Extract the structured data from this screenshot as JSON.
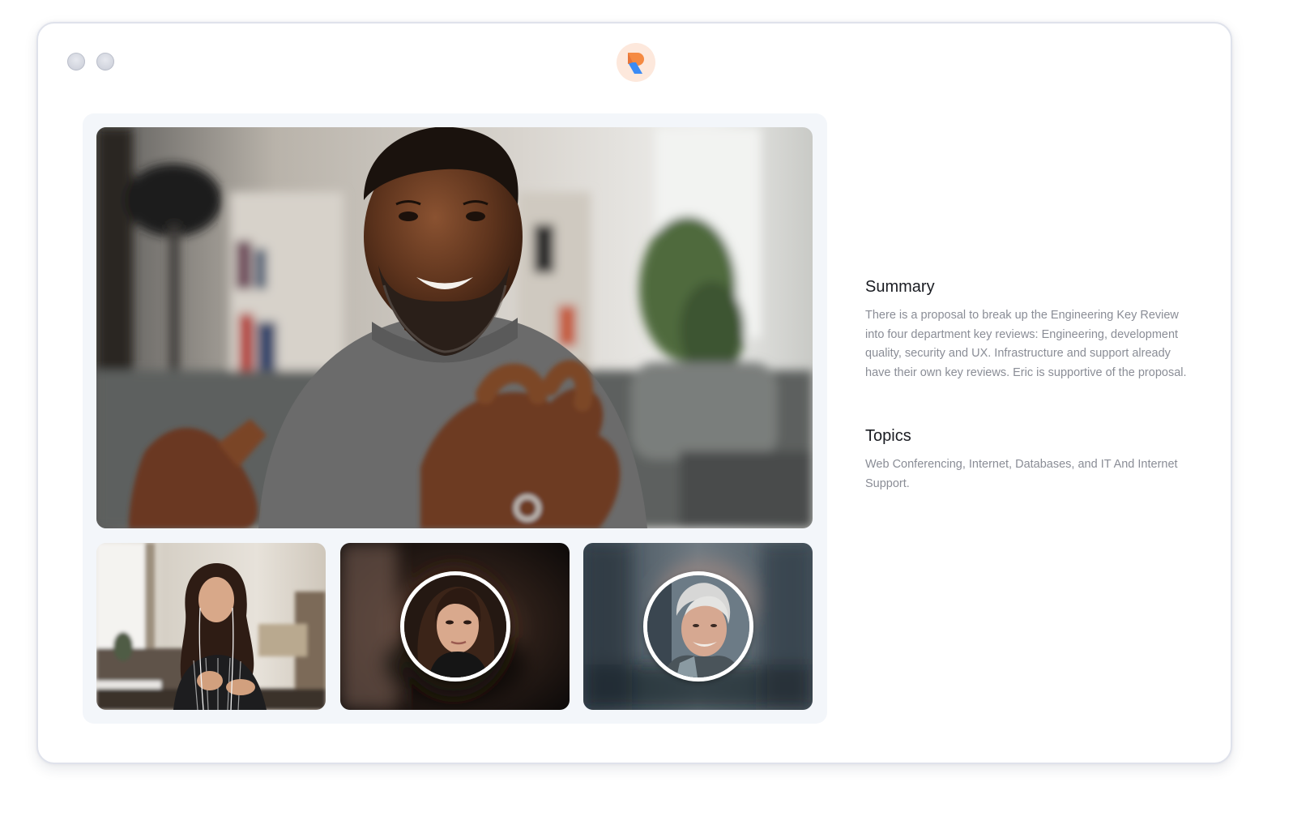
{
  "window": {
    "controls": [
      "window-control",
      "window-control"
    ],
    "logo_icon": "rewatch-logo-icon",
    "colors": {
      "logo_bg": "#fde8dc",
      "logo_orange": "#f58a42",
      "logo_blue": "#3b8bf5",
      "stage_bg": "#f3f6fa",
      "heading": "#1a1c22",
      "body_text": "#8a8d96"
    }
  },
  "call": {
    "main_participant": "speaker-video",
    "participants": [
      "participant-video-1",
      "participant-avatar-2",
      "participant-avatar-3"
    ]
  },
  "summary": {
    "title": "Summary",
    "body": "There is a proposal to break up the Engineering Key Review into four department key reviews: Engineering, development quality, security and UX. Infrastructure and support already have their own key reviews. Eric is supportive of the proposal."
  },
  "topics": {
    "title": "Topics",
    "body": "Web Conferencing, Internet, Databases, and IT And Internet Support."
  }
}
